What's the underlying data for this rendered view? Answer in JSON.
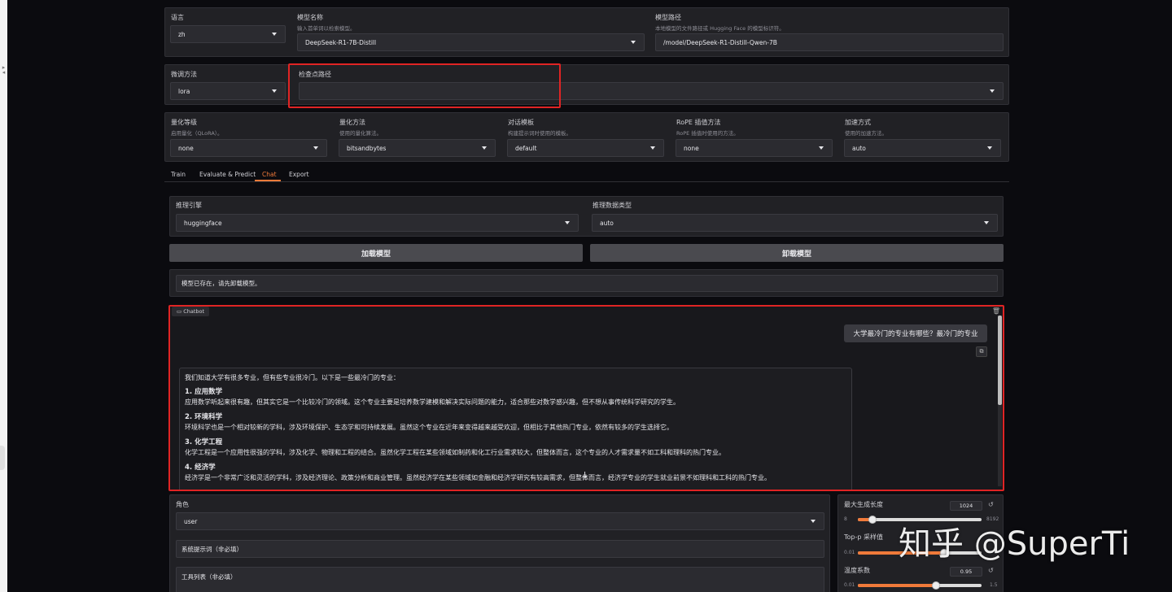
{
  "top": {
    "language": {
      "label": "语言",
      "value": "zh"
    },
    "model_name": {
      "label": "模型名称",
      "info": "输入首单词以检索模型。",
      "value": "DeepSeek-R1-7B-Distill"
    },
    "model_path": {
      "label": "模型路径",
      "info": "本地模型的文件路径或 Hugging Face 的模型标识符。",
      "value": "/model/DeepSeek-R1-Distill-Qwen-7B"
    }
  },
  "row2": {
    "finetune": {
      "label": "微调方法",
      "value": "lora"
    },
    "checkpoint": {
      "label": "检查点路径",
      "value": ""
    }
  },
  "row3": [
    {
      "label": "量化等级",
      "info": "启用量化（QLoRA）。",
      "value": "none"
    },
    {
      "label": "量化方法",
      "info": "使用的量化算法。",
      "value": "bitsandbytes"
    },
    {
      "label": "对话模板",
      "info": "构建提示词时使用的模板。",
      "value": "default"
    },
    {
      "label": "RoPE 插值方法",
      "info": "RoPE 插值时使用的方法。",
      "value": "none"
    },
    {
      "label": "加速方式",
      "info": "使用的加速方法。",
      "value": "auto"
    }
  ],
  "tabs": [
    "Train",
    "Evaluate & Predict",
    "Chat",
    "Export"
  ],
  "active_tab": "Chat",
  "infer": {
    "backend": {
      "label": "推理引擎",
      "value": "huggingface"
    },
    "dtype": {
      "label": "推理数据类型",
      "value": "auto"
    },
    "load_button": "加载模型",
    "unload_button": "卸载模型",
    "status": "模型已存在，请先卸载模型。"
  },
  "chatbot": {
    "label": "Chatbot",
    "user_message": "大学最冷门的专业有哪些？最冷门的专业",
    "assistant": {
      "intro": "我们知道大学有很多专业，但有些专业很冷门。以下是一些最冷门的专业：",
      "items": [
        {
          "title": "1. 应用数学",
          "body": "应用数学听起来很有趣，但其实它是一个比较冷门的领域。这个专业主要是培养数学建模和解决实际问题的能力，适合那些对数学感兴趣，但不想从事传统科学研究的学生。"
        },
        {
          "title": "2. 环境科学",
          "body": "环境科学也是一个相对较新的学科，涉及环境保护、生态学和可持续发展。虽然这个专业在近年来变得越来越受欢迎，但相比于其他热门专业，依然有较多的学生选择它。"
        },
        {
          "title": "3. 化学工程",
          "body": "化学工程是一个应用性很强的学科，涉及化学、物理和工程的结合。虽然化学工程在某些领域如制药和化工行业需求较大，但整体而言，这个专业的人才需求量不如工科和理科的热门专业。"
        },
        {
          "title": "4. 经济学",
          "body": "经济学是一个非常广泛和灵活的学科，涉及经济理论、政策分析和商业管理。虽然经济学在某些领域如金融和经济学研究有较高需求，但整体而言，经济学专业的学生就业前景不如理科和工科的热门专业。"
        }
      ]
    }
  },
  "input": {
    "role": {
      "label": "角色",
      "value": "user"
    },
    "system_placeholder": "系统提示词（非必填）",
    "tools_placeholder": "工具列表（非必填）"
  },
  "params": [
    {
      "label": "最大生成长度",
      "value": "1024",
      "min": "8",
      "max": "8192",
      "fraction": 0.12
    },
    {
      "label": "Top-p 采样值",
      "value": "0.7",
      "min": "0.01",
      "max": "1",
      "fraction": 0.7
    },
    {
      "label": "温度系数",
      "value": "0.95",
      "min": "0.01",
      "max": "1.5",
      "fraction": 0.63
    }
  ],
  "colors": {
    "accent": "#f07a3a",
    "highlight": "#e02424",
    "panel": "#212125",
    "field": "#2b2b30"
  },
  "watermark": "知乎 @SuperTi"
}
